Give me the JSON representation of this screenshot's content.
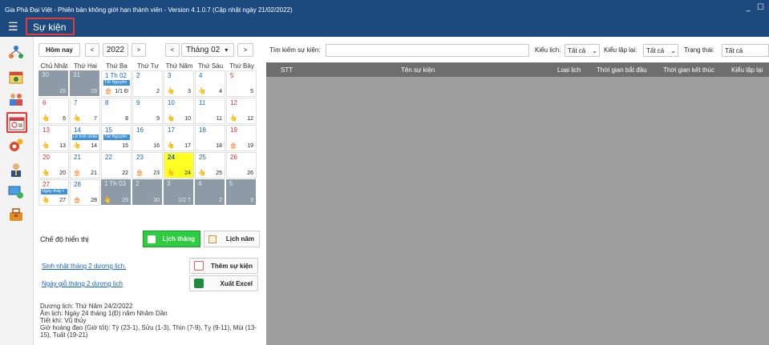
{
  "app": {
    "title": "Gia Phả Đại Việt - Phiên bản không giới hạn thành viên - Version 4.1.0.7 (Cập nhật ngày 21/02/2022)",
    "page_title": "Sự kiện",
    "window_controls": [
      "_",
      "☐"
    ]
  },
  "sidebar": {
    "icons": [
      "family-tree-icon",
      "calendar-icon",
      "people-icon",
      "event-calendar-icon",
      "settings-icon",
      "user-icon",
      "monitor-icon",
      "bag-icon"
    ]
  },
  "toolbar": {
    "today_label": "Hôm nay",
    "prev_year": "<",
    "year_value": "2022",
    "next_year": ">",
    "prev_month": "<",
    "month_value": "Tháng 02",
    "month_dropdown": "▾",
    "next_month": ">"
  },
  "calendar": {
    "weekdays": [
      "Chủ Nhật",
      "Thứ Hai",
      "Thứ Ba",
      "Thứ Tư",
      "Thứ Năm",
      "Thứ Sáu",
      "Thứ Bảy"
    ],
    "weeks": [
      [
        {
          "d": "30",
          "l": "29",
          "out": true
        },
        {
          "d": "31",
          "l": "29",
          "out": true
        },
        {
          "d": "1 Th 02",
          "l": "1/1 Đ",
          "ev": "Tết Nguyên",
          "icon": "cake"
        },
        {
          "d": "2",
          "l": "2"
        },
        {
          "d": "3",
          "l": "3",
          "icon": "hand"
        },
        {
          "d": "4",
          "l": "4",
          "icon": "hand"
        },
        {
          "d": "5",
          "l": "5",
          "red": true
        }
      ],
      [
        {
          "d": "6",
          "l": "6",
          "red": true,
          "icon": "hand"
        },
        {
          "d": "7",
          "l": "7",
          "icon": "hand"
        },
        {
          "d": "8",
          "l": "8"
        },
        {
          "d": "9",
          "l": "9"
        },
        {
          "d": "10",
          "l": "10",
          "icon": "hand"
        },
        {
          "d": "11",
          "l": "11"
        },
        {
          "d": "12",
          "l": "12",
          "red": true,
          "icon": "hand"
        }
      ],
      [
        {
          "d": "13",
          "l": "13",
          "red": true,
          "icon": "hand"
        },
        {
          "d": "14",
          "l": "14",
          "ev": "Lễ tình nhân",
          "icon": "hand"
        },
        {
          "d": "15",
          "l": "15",
          "ev": "Tết Nguyên"
        },
        {
          "d": "16",
          "l": "16"
        },
        {
          "d": "17",
          "l": "17",
          "icon": "hand"
        },
        {
          "d": "18",
          "l": "18"
        },
        {
          "d": "19",
          "l": "19",
          "red": true,
          "icon": "cake"
        }
      ],
      [
        {
          "d": "20",
          "l": "20",
          "red": true,
          "icon": "hand"
        },
        {
          "d": "21",
          "l": "21",
          "icon": "cake"
        },
        {
          "d": "22",
          "l": "22"
        },
        {
          "d": "23",
          "l": "23",
          "icon": "cake"
        },
        {
          "d": "24",
          "l": "24",
          "today": true,
          "icon": "hand"
        },
        {
          "d": "25",
          "l": "25",
          "icon": "hand"
        },
        {
          "d": "26",
          "l": "26",
          "red": true
        }
      ],
      [
        {
          "d": "27",
          "l": "27",
          "red": true,
          "ev": "Ngày thầy t",
          "icon": "hand"
        },
        {
          "d": "28",
          "l": "28",
          "icon": "cake"
        },
        {
          "d": "1 Th 03",
          "l": "29",
          "out": true,
          "icon": "hand"
        },
        {
          "d": "2",
          "l": "30",
          "out": true
        },
        {
          "d": "3",
          "l": "1/2 T",
          "out": true
        },
        {
          "d": "4",
          "l": "2",
          "out": true
        },
        {
          "d": "5",
          "l": "3",
          "out": true
        }
      ]
    ]
  },
  "mode": {
    "label": "Chế độ hiển thị",
    "month_btn": "Lịch tháng",
    "year_btn": "Lịch năm"
  },
  "actions": {
    "link_birthday": "Sinh nhật tháng 2 dương lịch.",
    "link_anniversary": "Ngày giỗ tháng 2 dương lịch",
    "add_event": "Thêm sự kiện",
    "export_excel": "Xuất Excel"
  },
  "info": {
    "solar": "Dương lịch: Thứ Năm 24/2/2022",
    "lunar": "Âm lịch:  Ngày 24 tháng 1(Đ) năm Nhâm Dần",
    "solar_term": "Tiết khí: Vũ thủy",
    "good_hours": "Giờ hoàng đạo (Giờ tốt): Tý (23-1), Sửu (1-3), Thìn (7-9), Tỵ (9-11), Mùi (13-15), Tuất (19-21)"
  },
  "search": {
    "label": "Tìm kiếm sự kiện:",
    "value": "",
    "calendar_type_label": "Kiểu lịch:",
    "calendar_type_value": "Tất cả",
    "repeat_label": "Kiểu lặp lại:",
    "repeat_value": "Tất cả",
    "status_label": "Trạng thái:",
    "status_value": "Tất cả"
  },
  "grid": {
    "columns": [
      "STT",
      "Tên sự kiện",
      "Loại lịch",
      "Thời gian bắt đầu",
      "Thời gian kết thúc",
      "Kiểu lặp lại"
    ]
  },
  "colors": {
    "titlebar": "#1c4a7e",
    "highlight_red": "#e53935",
    "today": "#ffff22",
    "event_blue": "#3d8fd6",
    "active_green": "#2ecc40"
  }
}
